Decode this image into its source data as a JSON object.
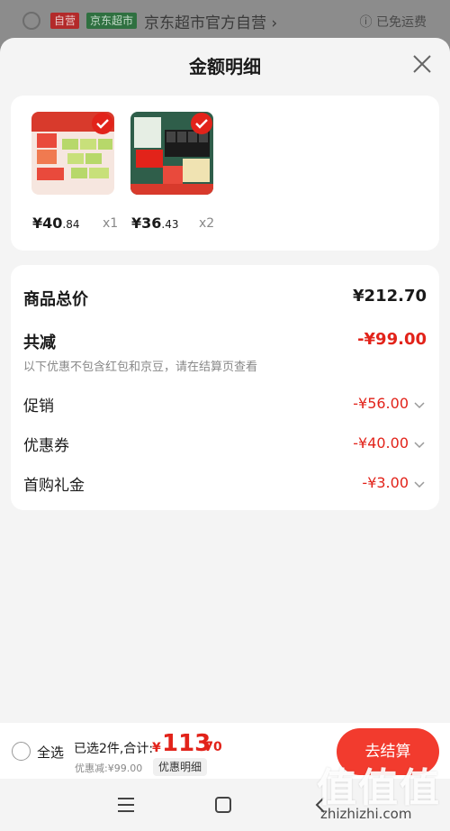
{
  "background": {
    "badge_self": "自营",
    "badge_market": "京东超市",
    "store_name": "京东超市官方自营 ›",
    "shipping": "ⓘ 已免运费"
  },
  "sheet": {
    "title": "金额明细"
  },
  "products": [
    {
      "price_main": "¥40",
      "price_dec": ".84",
      "qty": "x1"
    },
    {
      "price_main": "¥36",
      "price_dec": ".43",
      "qty": "x2"
    }
  ],
  "summary": {
    "total_label": "商品总价",
    "total_value": "¥212.70",
    "reduce_label": "共减",
    "reduce_value": "-¥99.00",
    "note": "以下优惠不包含红包和京豆，请在结算页查看",
    "discounts": [
      {
        "label": "促销",
        "value": "-¥56.00"
      },
      {
        "label": "优惠券",
        "value": "-¥40.00"
      },
      {
        "label": "首购礼金",
        "value": "-¥3.00"
      }
    ]
  },
  "bottom_bar": {
    "select_all": "全选",
    "selected_text": "已选2件,合计:",
    "currency": "¥",
    "total_int": "113",
    "total_dec": ".70",
    "saved": "优惠减:¥99.00",
    "detail_link": "优惠明细",
    "checkout": "去结算"
  },
  "watermark": {
    "logo": "值值值",
    "url": "zhizhizhi.com"
  },
  "colors": {
    "accent": "#e2231a",
    "checkout_bg": "#f23b2e"
  }
}
